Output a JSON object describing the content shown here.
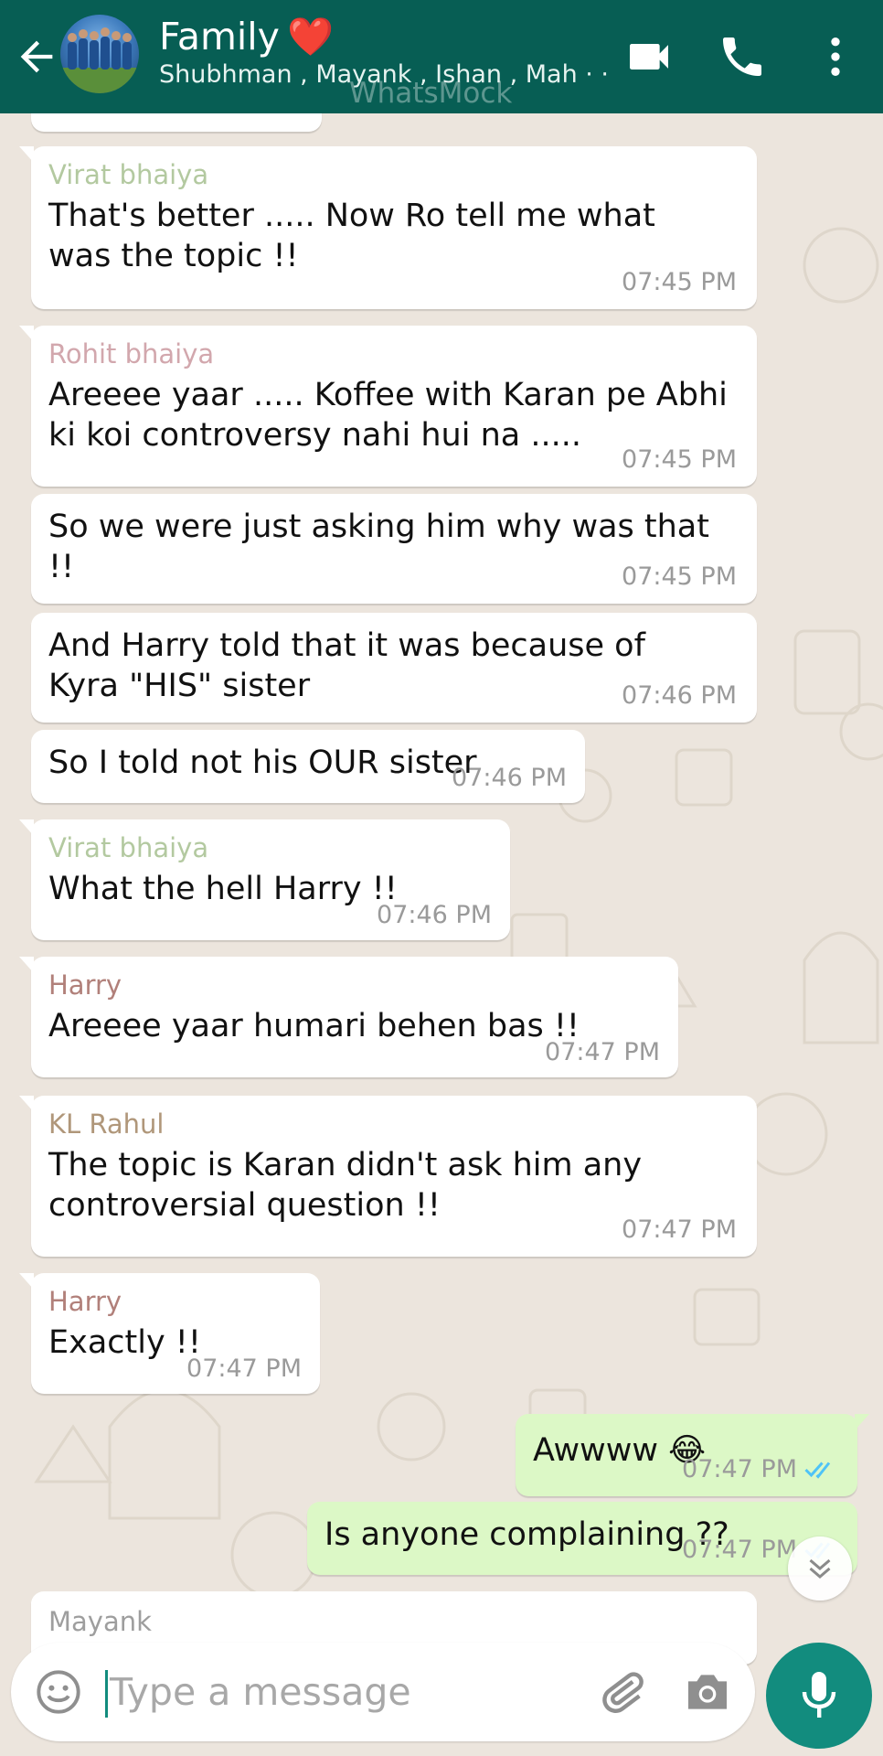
{
  "colors": {
    "header_bg": "#075e54",
    "chat_bg": "#ece5dd",
    "incoming_bubble": "#ffffff",
    "outgoing_bubble": "#dcf8c6",
    "accent": "#128c7e",
    "read_ticks": "#4fc3f7"
  },
  "header": {
    "back_icon": "arrow-left-icon",
    "avatar": "group-avatar",
    "title": "Family",
    "title_emoji": "❤️",
    "subtitle": "Shubhman , Mayank , Ishan , Mah · ·",
    "watermark": "WhatsMock",
    "icons": [
      "video-call-icon",
      "phone-icon",
      "more-vert-icon"
    ]
  },
  "messages": [
    {
      "sender": "Virat bhaiya",
      "sender_color": "#b3c9a0",
      "text": "That's better ..... Now Ro tell me what was the topic !!",
      "time": "07:45 PM"
    },
    {
      "sender": "Rohit bhaiya",
      "sender_color": "#d2a7ad",
      "text": "Areeee yaar ..... Koffee with Karan pe Abhi ki koi controversy nahi hui na .....",
      "time": "07:45 PM"
    },
    {
      "sender": "",
      "text": "So we were just asking him why was that !!",
      "time": "07:45 PM"
    },
    {
      "sender": "",
      "text": "And Harry told that it was because of Kyra \"HIS\" sister",
      "time": "07:46 PM"
    },
    {
      "sender": "",
      "text": "So I told not his OUR sister",
      "time": "07:46 PM"
    },
    {
      "sender": "Virat bhaiya",
      "sender_color": "#b3c9a0",
      "text": "What the hell Harry !!",
      "time": "07:46 PM"
    },
    {
      "sender": "Harry",
      "sender_color": "#b1807a",
      "text": "Areeee yaar humari behen bas !!",
      "time": "07:47 PM"
    },
    {
      "sender": "KL Rahul",
      "sender_color": "#b0977a",
      "text": "The topic is Karan didn't ask him any controversial question !!",
      "time": "07:47 PM"
    },
    {
      "sender": "Harry",
      "sender_color": "#b1807a",
      "text": "Exactly !!",
      "time": "07:47 PM"
    },
    {
      "outgoing": true,
      "text": "Awwww 😂",
      "time": "07:47 PM",
      "status": "read"
    },
    {
      "outgoing": true,
      "text": "Is anyone complaining ??",
      "time": "07:47 PM",
      "status": "read"
    },
    {
      "sender": "Mayank",
      "sender_color": "#9e9e9e",
      "text": "",
      "time": ""
    }
  ],
  "scroll_down_icon": "double-chevron-down-icon",
  "input": {
    "placeholder": "Type a message",
    "emoji_icon": "emoji-icon",
    "attach_icon": "paperclip-icon",
    "camera_icon": "camera-icon",
    "mic_icon": "mic-icon"
  }
}
